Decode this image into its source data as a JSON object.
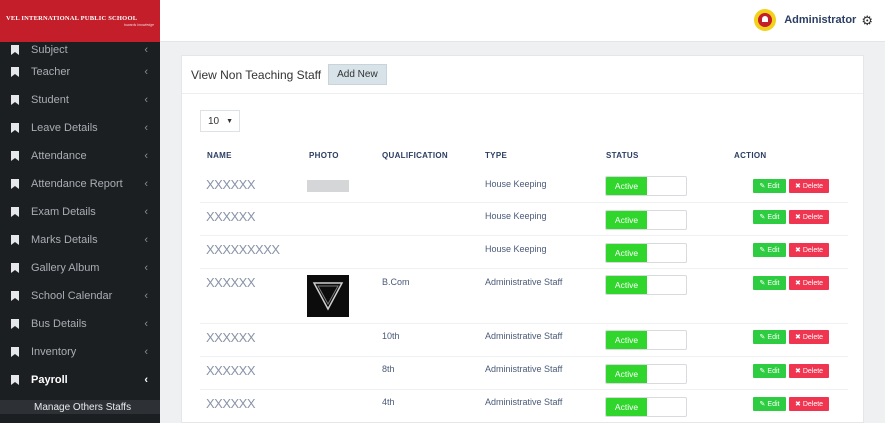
{
  "brand": {
    "name": "VEL INTERNATIONAL PUBLIC SCHOOL",
    "tagline": "towards knowledge"
  },
  "sidebar": {
    "items": [
      {
        "label": "Subject"
      },
      {
        "label": "Teacher"
      },
      {
        "label": "Student"
      },
      {
        "label": "Leave Details"
      },
      {
        "label": "Attendance"
      },
      {
        "label": "Attendance Report"
      },
      {
        "label": "Exam Details"
      },
      {
        "label": "Marks Details"
      },
      {
        "label": "Gallery Album"
      },
      {
        "label": "School Calendar"
      },
      {
        "label": "Bus Details"
      },
      {
        "label": "Inventory"
      },
      {
        "label": "Payroll"
      }
    ],
    "sub_item": "Manage Others Staffs",
    "chevron": "‹"
  },
  "header": {
    "user": "Administrator"
  },
  "main": {
    "title": "View Non Teaching Staff",
    "add_label": "Add New",
    "page_length": "10",
    "columns": [
      "NAME",
      "PHOTO",
      "QUALIFICATION",
      "TYPE",
      "STATUS",
      "ACTION"
    ],
    "rows": [
      {
        "name": "XXXXXX",
        "qualification": "",
        "type": "House Keeping",
        "status": "Active"
      },
      {
        "name": "XXXXXX",
        "qualification": "",
        "type": "House Keeping",
        "status": "Active"
      },
      {
        "name": "XXXXXXXXX",
        "qualification": "",
        "type": "House Keeping",
        "status": "Active"
      },
      {
        "name": "XXXXXX",
        "qualification": "B.Com",
        "type": "Administrative Staff",
        "status": "Active"
      },
      {
        "name": "XXXXXX",
        "qualification": "10th",
        "type": "Administrative Staff",
        "status": "Active"
      },
      {
        "name": "XXXXXX",
        "qualification": "8th",
        "type": "Administrative Staff",
        "status": "Active"
      },
      {
        "name": "XXXXXX",
        "qualification": "4th",
        "type": "Administrative Staff",
        "status": "Active"
      }
    ],
    "edit_label": "Edit",
    "delete_label": "Delete"
  },
  "colors": {
    "brand_red": "#c41e2a",
    "active_green": "#31d62d",
    "delete_red": "#ef3550",
    "sidebar_bg": "#1c1f22"
  }
}
